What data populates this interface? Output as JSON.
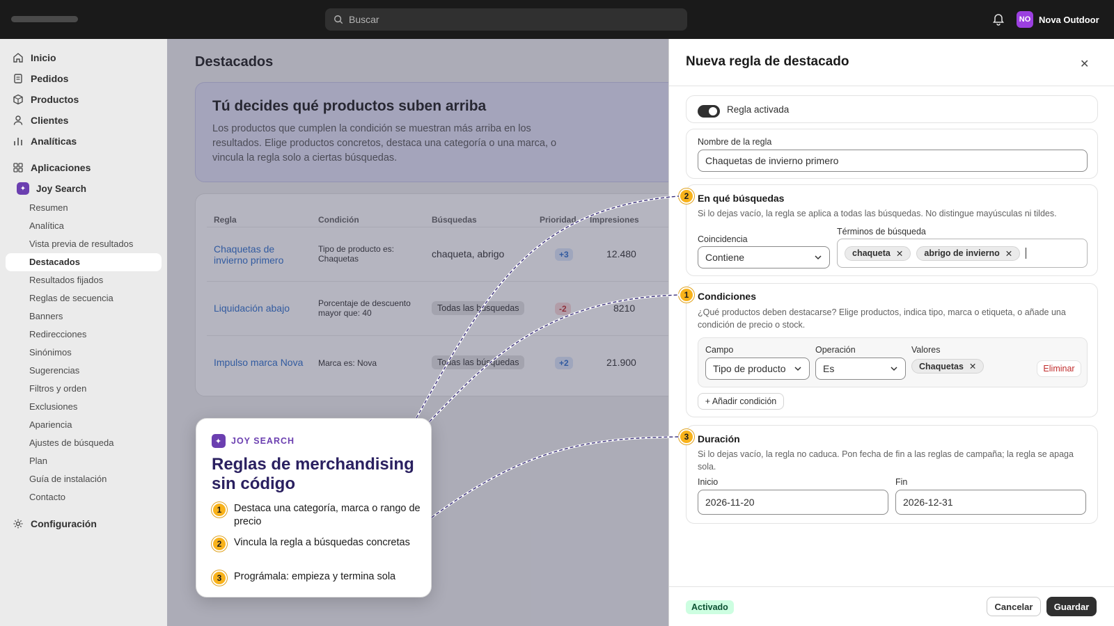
{
  "topbar": {
    "search_placeholder": "Buscar",
    "store_initials": "NO",
    "store_name": "Nova Outdoor"
  },
  "sidebar": {
    "primary": [
      "Inicio",
      "Pedidos",
      "Productos",
      "Clientes",
      "Analíticas"
    ],
    "apps_label": "Aplicaciones",
    "app_name": "Joy Search",
    "app_items": [
      "Resumen",
      "Analítica",
      "Vista previa de resultados",
      "Destacados",
      "Resultados fijados",
      "Reglas de secuencia",
      "Banners",
      "Redirecciones",
      "Sinónimos",
      "Sugerencias",
      "Filtros y orden",
      "Exclusiones",
      "Apariencia",
      "Ajustes de búsqueda",
      "Plan",
      "Guía de instalación",
      "Contacto"
    ],
    "settings_label": "Configuración"
  },
  "main": {
    "title": "Destacados",
    "hero_title": "Tú decides qué productos suben arriba",
    "hero_text": "Los productos que cumplen la condición se muestran más arriba en los resultados. Elige productos concretos, destaca una categoría o una marca, o vincula la regla solo a ciertas búsquedas.",
    "columns": [
      "Regla",
      "Condición",
      "Búsquedas",
      "Prioridad",
      "Impresiones"
    ],
    "rows": [
      {
        "rule": "Chaquetas de invierno primero",
        "condition": "Tipo de producto es: Chaquetas",
        "searches": "chaqueta, abrigo",
        "priority": "+3",
        "impressions": "12.480"
      },
      {
        "rule": "Liquidación abajo",
        "condition": "Porcentaje de descuento mayor que: 40",
        "searches": "Todas las búsquedas",
        "priority": "-2",
        "impressions": "8210"
      },
      {
        "rule": "Impulso marca Nova",
        "condition": "Marca es: Nova",
        "searches": "Todas las búsquedas",
        "priority": "+2",
        "impressions": "21.900"
      }
    ]
  },
  "panel": {
    "title": "Nueva regla de destacado",
    "toggle_label": "Regla activada",
    "name_label": "Nombre de la regla",
    "name_value": "Chaquetas de invierno primero",
    "searches_title": "En qué búsquedas",
    "searches_help": "Si lo dejas vacío, la regla se aplica a todas las búsquedas. No distingue mayúsculas ni tildes.",
    "match_label": "Coincidencia",
    "match_value": "Contiene",
    "terms_label": "Términos de búsqueda",
    "terms": [
      "chaqueta",
      "abrigo de invierno"
    ],
    "conditions_title": "Condiciones",
    "conditions_help": "¿Qué productos deben destacarse? Elige productos, indica tipo, marca o etiqueta, o añade una condición de precio o stock.",
    "field_label": "Campo",
    "field_value": "Tipo de producto",
    "op_label": "Operación",
    "op_value": "Es",
    "values_label": "Valores",
    "values": [
      "Chaquetas"
    ],
    "remove_label": "Eliminar",
    "add_condition": "+ Añadir condición",
    "duration_title": "Duración",
    "duration_help": "Si lo dejas vacío, la regla no caduca. Pon fecha de fin a las reglas de campaña; la regla se apaga sola.",
    "start_label": "Inicio",
    "start_value": "2026-11-20",
    "end_label": "Fin",
    "end_value": "2026-12-31",
    "status": "Activado",
    "cancel": "Cancelar",
    "save": "Guardar",
    "badges": [
      "2",
      "1",
      "3"
    ]
  },
  "promo": {
    "brand": "JOY SEARCH",
    "title": "Reglas de merchandising sin código",
    "items": [
      {
        "n": "1",
        "text": "Destaca una categoría, marca o rango de precio"
      },
      {
        "n": "2",
        "text": "Vincula la regla a búsquedas concretas"
      },
      {
        "n": "3",
        "text": "Prográmala: empieza y termina sola"
      }
    ]
  },
  "colors": {
    "accent": "#6b3fb0",
    "badge": "#f8b21a",
    "link": "#2c6ecb",
    "status_green": "#cdfee1"
  }
}
